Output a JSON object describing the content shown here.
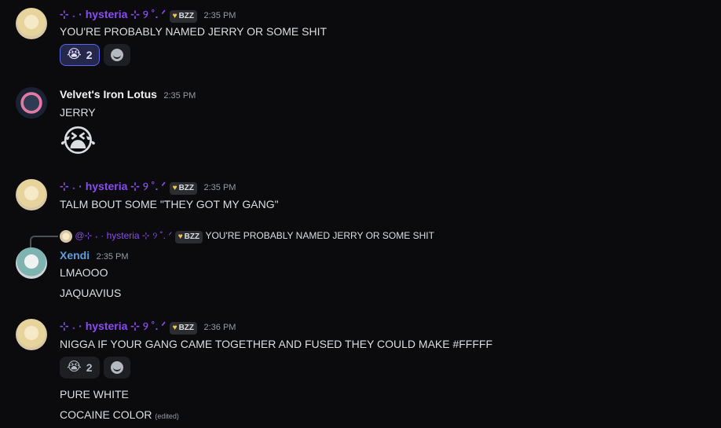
{
  "messages": [
    {
      "author": "⊹ ˖ · hysteria ⊹ ୨ ˚. ᐟ",
      "tag": "BZZ",
      "time": "2:35 PM",
      "lines": [
        "YOU'RE PROBABLY NAMED JERRY OR SOME SHIT"
      ],
      "reaction": {
        "emoji": "😭",
        "count": "2"
      }
    },
    {
      "author": "Velvet's Iron Lotus",
      "time": "2:35 PM",
      "lines": [
        "JERRY"
      ],
      "big_emoji": "😭"
    },
    {
      "author": "⊹ ˖ · hysteria ⊹ ୨ ˚. ᐟ",
      "tag": "BZZ",
      "time": "2:35 PM",
      "lines": [
        "TALM BOUT SOME \"THEY GOT MY GANG\""
      ]
    },
    {
      "reply_to": {
        "author": "@⊹ ˖ · hysteria ⊹ ୨ ˚. ᐟ",
        "tag": "BZZ",
        "text": "YOU'RE PROBABLY NAMED JERRY OR SOME SHIT"
      },
      "author": "Xendi",
      "time": "2:35 PM",
      "lines": [
        "LMAOOO",
        "JAQUAVIUS"
      ]
    },
    {
      "author": "⊹ ˖ · hysteria ⊹ ୨ ˚. ᐟ",
      "tag": "BZZ",
      "time": "2:36 PM",
      "lines": [
        "NIGGA IF YOUR GANG CAME TOGETHER AND FUSED THEY COULD MAKE #FFFFF",
        "PURE WHITE",
        "COCAINE COLOR"
      ],
      "edited": "(edited)",
      "reaction": {
        "emoji": "😭",
        "count": "2"
      }
    }
  ]
}
